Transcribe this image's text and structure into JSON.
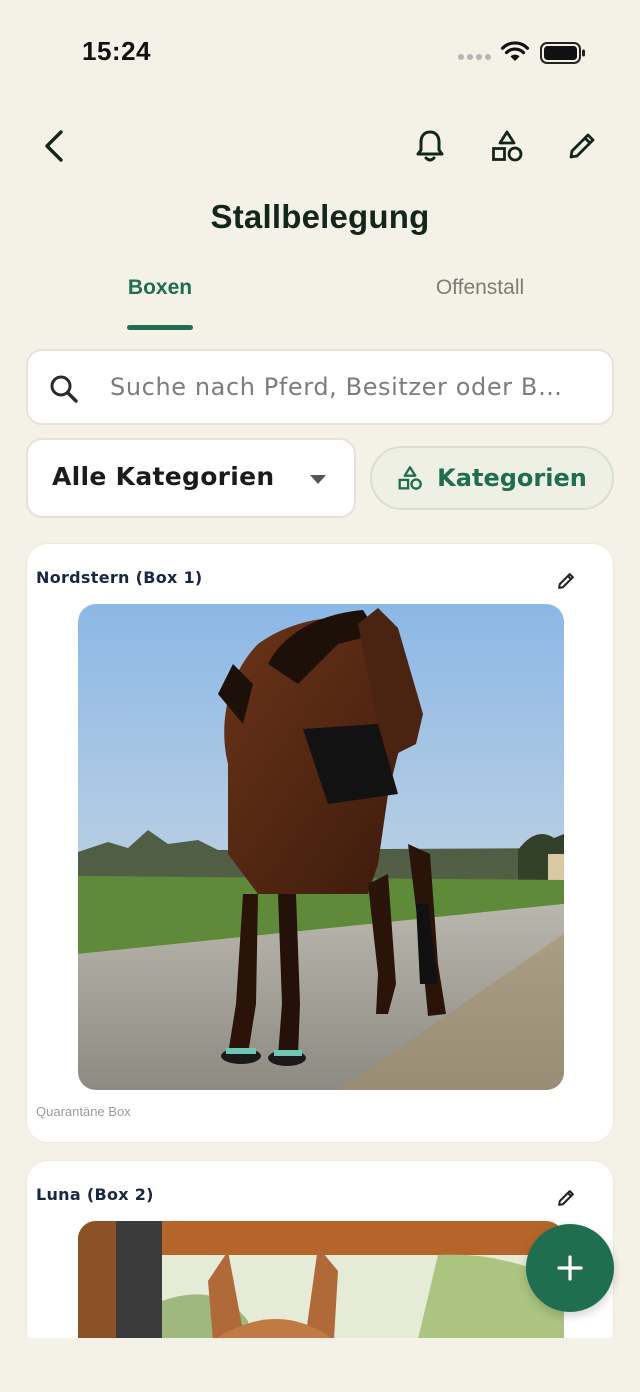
{
  "status_bar": {
    "time": "15:24"
  },
  "header": {
    "title": "Stallbelegung",
    "icons": [
      "back-arrow-icon",
      "bell-icon",
      "shapes-icon",
      "pencil-icon"
    ]
  },
  "tabs": [
    {
      "label": "Boxen",
      "active": true
    },
    {
      "label": "Offenstall",
      "active": false
    }
  ],
  "search": {
    "placeholder": "Suche nach Pferd, Besitzer oder B…",
    "value": ""
  },
  "filters": {
    "category_select": "Alle Kategorien",
    "categories_button": "Kategorien"
  },
  "boxes": [
    {
      "title": "Nordstern (Box 1)",
      "caption": "Quarantäne Box"
    },
    {
      "title": "Luna (Box 2)",
      "caption": ""
    }
  ],
  "colors": {
    "accent": "#1f6e4f",
    "background": "#f4f1e6",
    "card": "#ffffff"
  }
}
